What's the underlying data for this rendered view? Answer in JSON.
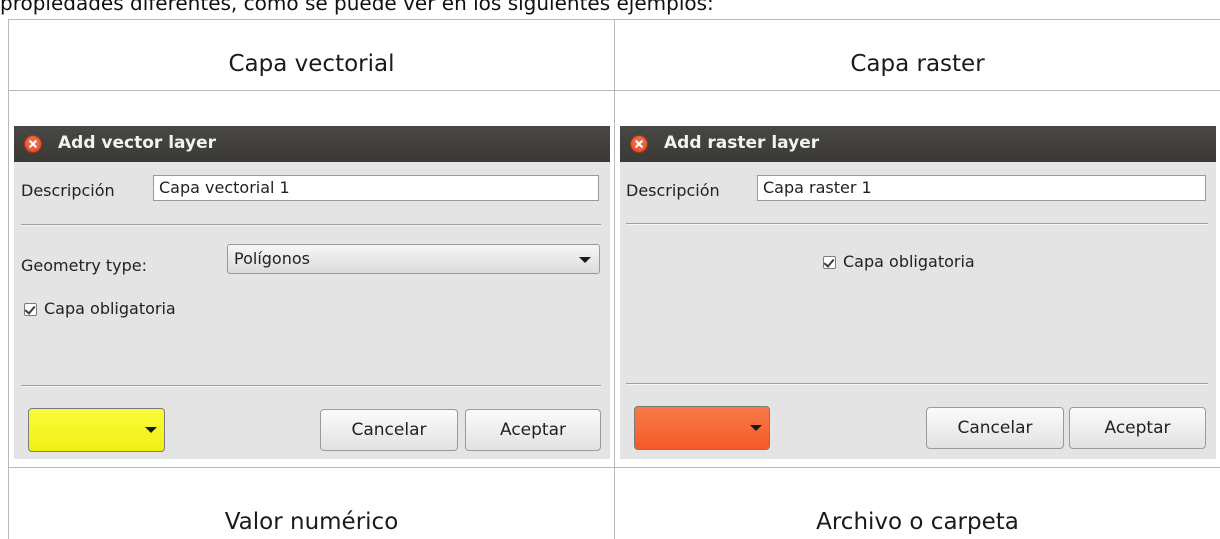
{
  "intro_text": "propiedades diferentes, como se puede ver en los siguientes ejemplos:",
  "captions": {
    "vector": "Capa vectorial",
    "raster": "Capa raster",
    "numeric": "Valor numérico",
    "file": "Archivo o carpeta"
  },
  "vector_dialog": {
    "title": "Add vector layer",
    "description_label": "Descripción",
    "description_value": "Capa vectorial 1",
    "geometry_label": "Geometry type:",
    "geometry_value": "Polígonos",
    "mandatory_label": "Capa obligatoria",
    "mandatory_checked": true,
    "color": "#f6f61e",
    "cancel_label": "Cancelar",
    "accept_label": "Aceptar"
  },
  "raster_dialog": {
    "title": "Add raster layer",
    "description_label": "Descripción",
    "description_value": "Capa raster 1",
    "mandatory_label": "Capa obligatoria",
    "mandatory_checked": true,
    "color": "#f76131",
    "cancel_label": "Cancelar",
    "accept_label": "Aceptar"
  },
  "icons": {
    "close": "close-icon",
    "dropdown": "chevron-down-icon",
    "check": "checkbox-checked-icon"
  }
}
